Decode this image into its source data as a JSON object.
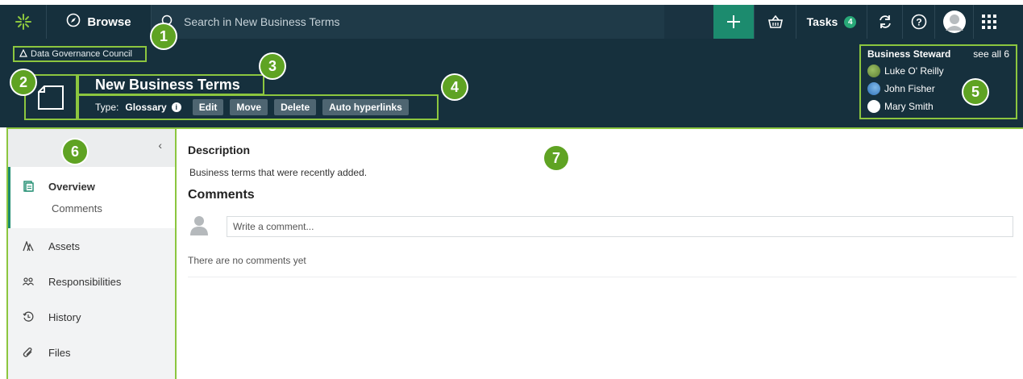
{
  "topbar": {
    "browse_label": "Browse",
    "search_placeholder": "Search in New Business Terms",
    "tasks_label": "Tasks",
    "tasks_count": "4"
  },
  "header": {
    "community": "Data Governance Council",
    "title": "New Business Terms",
    "type_label": "Type:",
    "type_value": "Glossary",
    "actions": [
      "Edit",
      "Move",
      "Delete",
      "Auto hyperlinks"
    ],
    "steward": {
      "heading": "Business Steward",
      "see_all": "see all 6",
      "people": [
        "Luke O' Reilly",
        "John Fisher",
        "Mary Smith"
      ]
    }
  },
  "sidebar": {
    "items": [
      {
        "label": "Overview",
        "icon": "overview-icon"
      },
      {
        "label": "Comments"
      },
      {
        "label": "Assets",
        "icon": "assets-icon"
      },
      {
        "label": "Responsibilities",
        "icon": "responsibilities-icon"
      },
      {
        "label": "History",
        "icon": "history-icon"
      },
      {
        "label": "Files",
        "icon": "paperclip-icon"
      }
    ]
  },
  "main": {
    "description_heading": "Description",
    "description_text": "Business terms that were recently added.",
    "comments_heading": "Comments",
    "comment_placeholder": "Write a comment...",
    "no_comments": "There are no comments yet"
  },
  "callouts": [
    "1",
    "2",
    "3",
    "4",
    "5",
    "6",
    "7"
  ],
  "colors": {
    "header_bg": "#16303d",
    "accent": "#1c8b6e",
    "callout": "#5fa323",
    "highlight_border": "#8cc63f"
  }
}
